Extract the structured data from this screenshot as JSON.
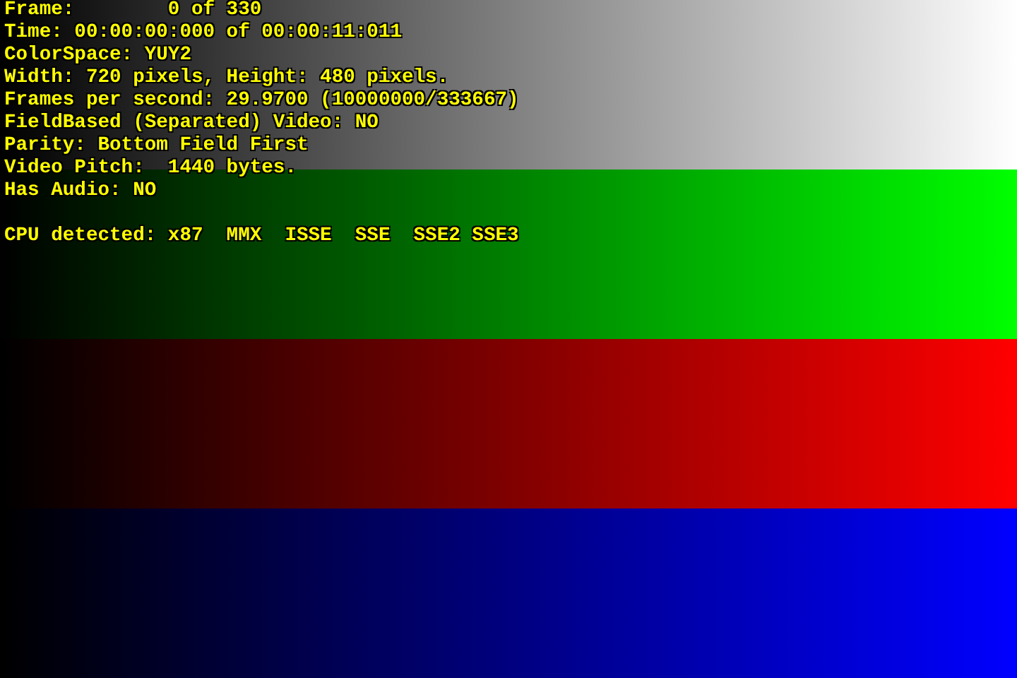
{
  "bands": [
    {
      "color": "#ffffff"
    },
    {
      "color": "#00ff00"
    },
    {
      "color": "#ff0000"
    },
    {
      "color": "#0000ff"
    }
  ],
  "info_lines": [
    "Frame:        0 of 330",
    "Time: 00:00:00:000 of 00:00:11:011",
    "ColorSpace: YUY2",
    "Width: 720 pixels, Height: 480 pixels.",
    "Frames per second: 29.9700 (10000000/333667)",
    "FieldBased (Separated) Video: NO",
    "Parity: Bottom Field First",
    "Video Pitch:  1440 bytes.",
    "Has Audio: NO"
  ],
  "cpu_line": "CPU detected: x87  MMX  ISSE  SSE  SSE2 SSE3"
}
